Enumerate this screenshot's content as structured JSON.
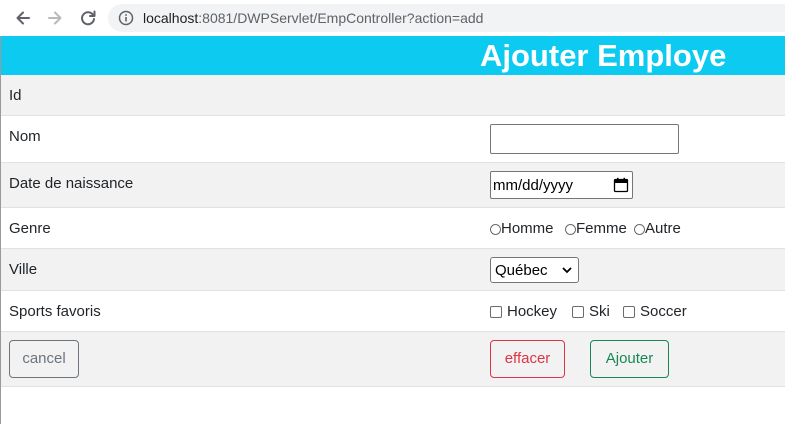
{
  "browser": {
    "url_host": "localhost",
    "url_path": ":8081/DWPServlet/EmpController?action=add",
    "back_icon": "arrow-left-icon",
    "forward_icon": "arrow-right-icon",
    "reload_icon": "reload-icon",
    "site_info_icon": "info-icon"
  },
  "header": {
    "title": "Ajouter Employe",
    "background_color": "#0dcaf0"
  },
  "form": {
    "id_label": "Id",
    "nom_label": "Nom",
    "nom_value": "",
    "birthdate_label": "Date de naissance",
    "birthdate_placeholder": "mm/dd/yyyy",
    "genre_label": "Genre",
    "genre_options": [
      "Homme",
      "Femme",
      "Autre"
    ],
    "ville_label": "Ville",
    "ville_selected": "Québec",
    "sports_label": "Sports favoris",
    "sports_options": [
      "Hockey",
      "Ski",
      "Soccer"
    ]
  },
  "actions": {
    "cancel": "cancel",
    "clear": "effacer",
    "add": "Ajouter"
  },
  "colors": {
    "cancel": "#6c757d",
    "clear": "#dc3545",
    "add": "#198754",
    "stripe": "#f2f2f2"
  }
}
